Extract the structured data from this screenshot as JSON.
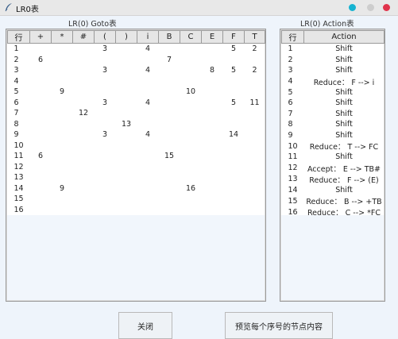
{
  "window": {
    "title": "LR0表"
  },
  "goto": {
    "caption": "LR(0) Goto表",
    "headers": [
      "行",
      "+",
      "*",
      "#",
      "(",
      ")",
      "i",
      "B",
      "C",
      "E",
      "F",
      "T"
    ],
    "rows": [
      [
        "1",
        "",
        "",
        "",
        "3",
        "",
        "4",
        "",
        "",
        "",
        "5",
        "2"
      ],
      [
        "2",
        "6",
        "",
        "",
        "",
        "",
        "",
        "7",
        "",
        "",
        "",
        ""
      ],
      [
        "3",
        "",
        "",
        "",
        "3",
        "",
        "4",
        "",
        "",
        "8",
        "5",
        "2"
      ],
      [
        "4",
        "",
        "",
        "",
        "",
        "",
        "",
        "",
        "",
        "",
        "",
        ""
      ],
      [
        "5",
        "",
        "9",
        "",
        "",
        "",
        "",
        "",
        "10",
        "",
        "",
        ""
      ],
      [
        "6",
        "",
        "",
        "",
        "3",
        "",
        "4",
        "",
        "",
        "",
        "5",
        "11"
      ],
      [
        "7",
        "",
        "",
        "12",
        "",
        "",
        "",
        "",
        "",
        "",
        "",
        ""
      ],
      [
        "8",
        "",
        "",
        "",
        "",
        "13",
        "",
        "",
        "",
        "",
        "",
        ""
      ],
      [
        "9",
        "",
        "",
        "",
        "3",
        "",
        "4",
        "",
        "",
        "",
        "14",
        ""
      ],
      [
        "10",
        "",
        "",
        "",
        "",
        "",
        "",
        "",
        "",
        "",
        "",
        ""
      ],
      [
        "11",
        "6",
        "",
        "",
        "",
        "",
        "",
        "15",
        "",
        "",
        "",
        ""
      ],
      [
        "12",
        "",
        "",
        "",
        "",
        "",
        "",
        "",
        "",
        "",
        "",
        ""
      ],
      [
        "13",
        "",
        "",
        "",
        "",
        "",
        "",
        "",
        "",
        "",
        "",
        ""
      ],
      [
        "14",
        "",
        "9",
        "",
        "",
        "",
        "",
        "",
        "16",
        "",
        "",
        ""
      ],
      [
        "15",
        "",
        "",
        "",
        "",
        "",
        "",
        "",
        "",
        "",
        "",
        ""
      ],
      [
        "16",
        "",
        "",
        "",
        "",
        "",
        "",
        "",
        "",
        "",
        "",
        ""
      ]
    ]
  },
  "action": {
    "caption": "LR(0) Action表",
    "headers": [
      "行",
      "Action"
    ],
    "rows": [
      [
        "1",
        "Shift"
      ],
      [
        "2",
        "Shift"
      ],
      [
        "3",
        "Shift"
      ],
      [
        "4",
        "Reduce： F --> i"
      ],
      [
        "5",
        "Shift"
      ],
      [
        "6",
        "Shift"
      ],
      [
        "7",
        "Shift"
      ],
      [
        "8",
        "Shift"
      ],
      [
        "9",
        "Shift"
      ],
      [
        "10",
        "Reduce： T --> FC"
      ],
      [
        "11",
        "Shift"
      ],
      [
        "12",
        "Accept： E --> TB#"
      ],
      [
        "13",
        "Reduce： F --> (E)"
      ],
      [
        "14",
        "Shift"
      ],
      [
        "15",
        "Reduce： B --> +TB"
      ],
      [
        "16",
        "Reduce： C --> *FC"
      ]
    ]
  },
  "buttons": {
    "close": "关闭",
    "preview": "预览每个序号的节点内容"
  },
  "colors": {
    "dot_cyan": "#16b3d1",
    "dot_grey": "#cdcdcd",
    "dot_red": "#e0334b"
  }
}
